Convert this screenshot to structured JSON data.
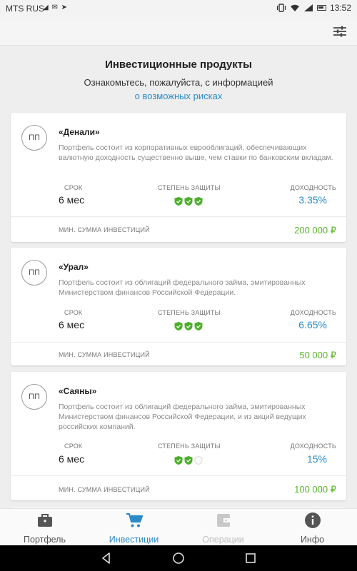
{
  "status_bar": {
    "carrier": "MTS RUS",
    "time": "13:52",
    "icons": "◢ ✉ ➤"
  },
  "header": {
    "title": "Инвестиционные продукты",
    "subtitle": "Ознакомьтесь, пожалуйста, с информацией",
    "risk_link": "о возможных рисках"
  },
  "labels": {
    "term": "СРОК",
    "protection": "СТЕПЕНЬ ЗАЩИТЫ",
    "yield": "ДОХОДНОСТЬ",
    "min_investment": "МИН. СУММА ИНВЕСТИЦИЙ"
  },
  "products": [
    {
      "avatar": "ПП",
      "name": "«Денали»",
      "description": "Портфель состоит из корпоративных еврооблигаций, обеспечивающих валютную доходность существенно выше, чем ставки по банковским вкладам.",
      "term": "6 мес",
      "protection_level": 3,
      "yield": "3.35%",
      "min_sum": "200 000 ₽"
    },
    {
      "avatar": "ПП",
      "name": "«Урал»",
      "description": "Портфель состоит из облигаций федерального займа, эмитированных Министерством финансов Российской Федерации.",
      "term": "6 мес",
      "protection_level": 3,
      "yield": "6.65%",
      "min_sum": "50 000 ₽"
    },
    {
      "avatar": "ПП",
      "name": "«Саяны»",
      "description": "Портфель состоит из облигаций федерального займа, эмитированных Министерством финансов Российской Федерации, и из акций ведущих российских компаний.",
      "term": "6 мес",
      "protection_level": 2,
      "yield": "15%",
      "min_sum": "100 000 ₽"
    }
  ],
  "bottom_nav": {
    "portfolio": "Портфель",
    "investments": "Инвестиции",
    "operations": "Операции",
    "info": "Инфо"
  },
  "colors": {
    "accent": "#2a8bc8",
    "green": "#58b52a",
    "shield_on": "#4caf2a",
    "shield_off": "#d8d8d8"
  }
}
